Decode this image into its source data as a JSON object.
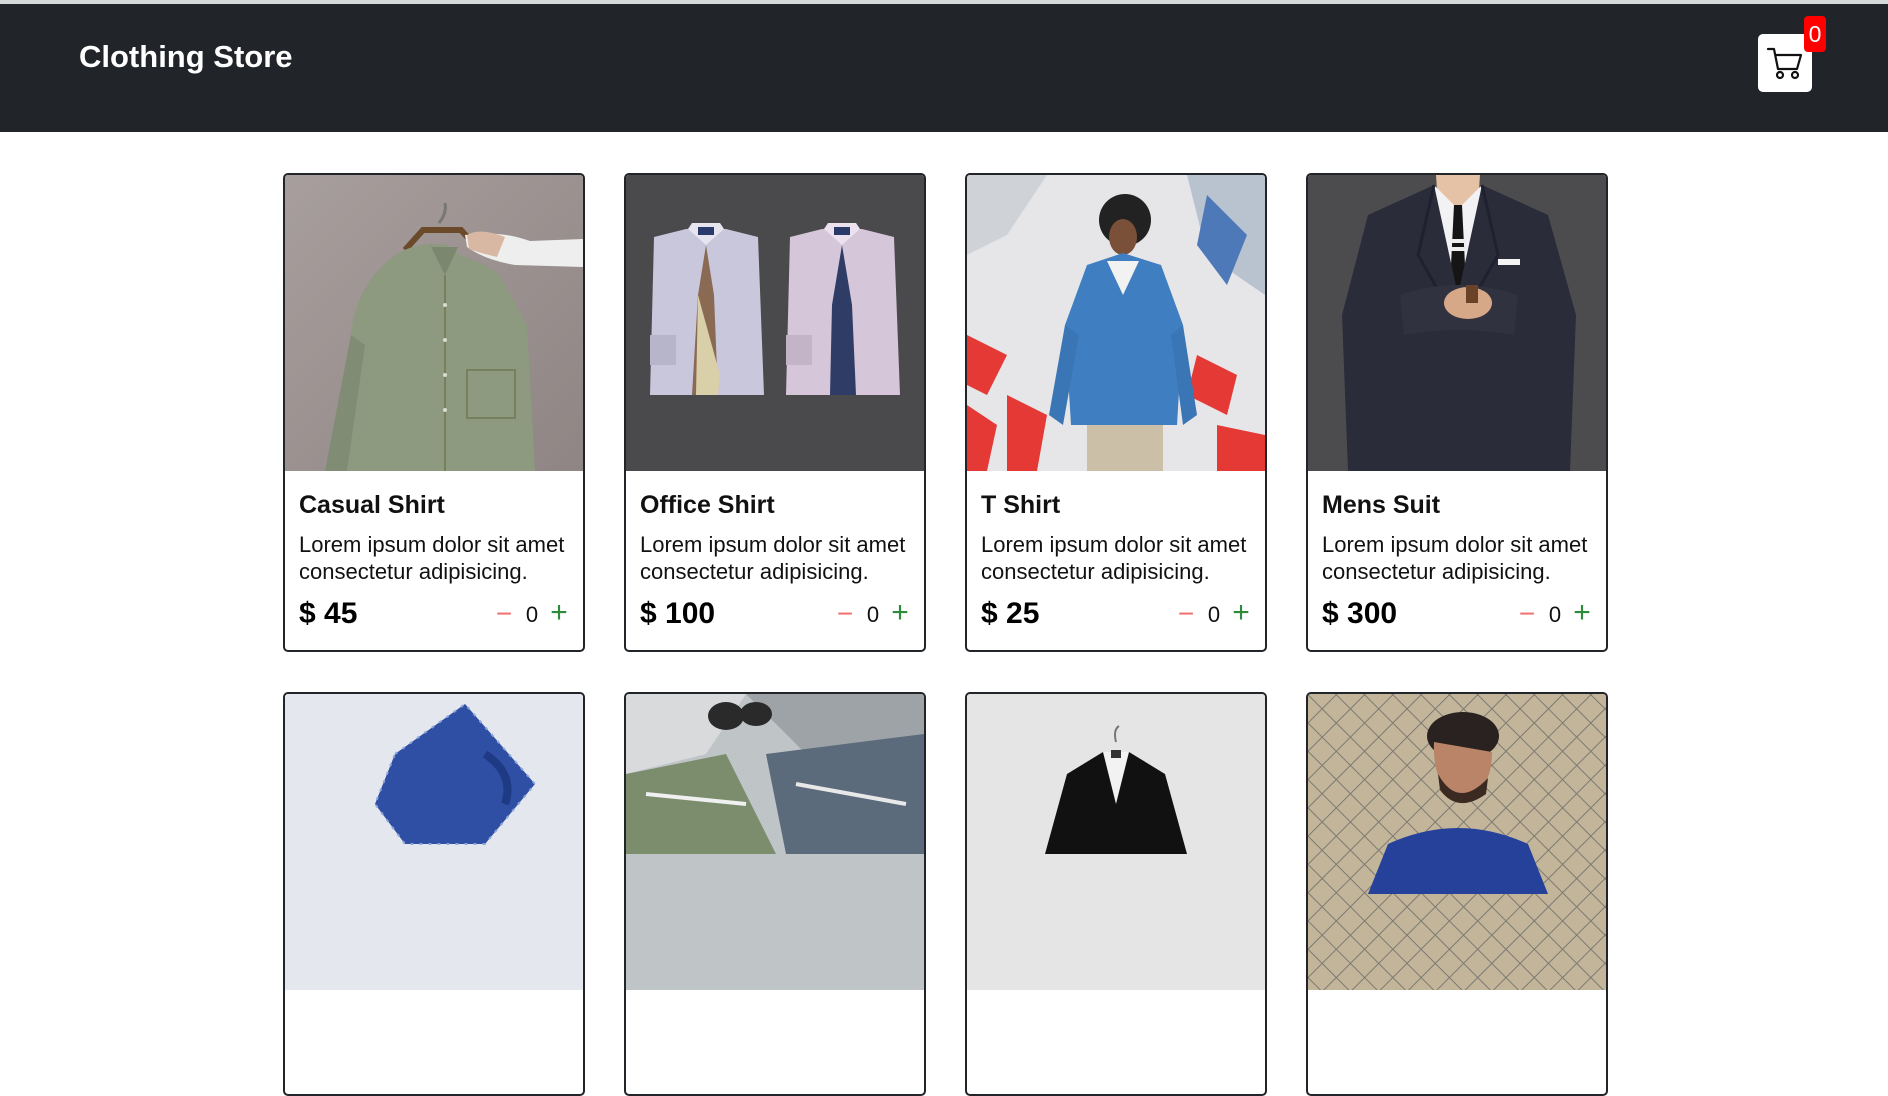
{
  "navbar": {
    "brand": "Clothing Store",
    "cart_count": "0",
    "cart_icon": "shopping-cart-icon"
  },
  "colors": {
    "navbar_bg": "#212529",
    "badge_bg": "#ff0000",
    "minus_color": "#f07070",
    "plus_color": "#2e8b3a"
  },
  "products": [
    {
      "title": "Casual Shirt",
      "description": "Lorem ipsum dolor sit amet consectetur adipisicing.",
      "price": "$ 45",
      "qty": "0",
      "minus": "−",
      "plus": "+"
    },
    {
      "title": "Office Shirt",
      "description": "Lorem ipsum dolor sit amet consectetur adipisicing.",
      "price": "$ 100",
      "qty": "0",
      "minus": "−",
      "plus": "+"
    },
    {
      "title": "T Shirt",
      "description": "Lorem ipsum dolor sit amet consectetur adipisicing.",
      "price": "$ 25",
      "qty": "0",
      "minus": "−",
      "plus": "+"
    },
    {
      "title": "Mens Suit",
      "description": "Lorem ipsum dolor sit amet consectetur adipisicing.",
      "price": "$ 300",
      "qty": "0",
      "minus": "−",
      "plus": "+"
    }
  ]
}
